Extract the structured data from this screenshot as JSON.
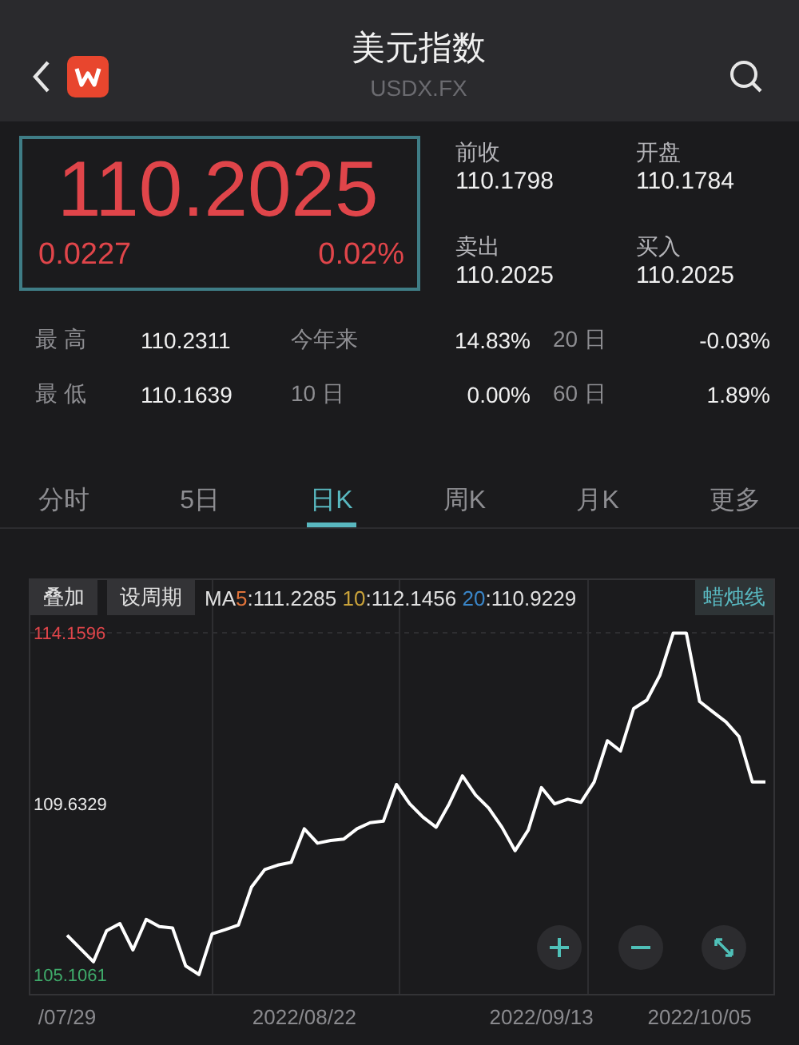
{
  "header": {
    "title": "美元指数",
    "subtitle": "USDX.FX"
  },
  "quote": {
    "price": "110.2025",
    "change": "0.0227",
    "change_pct": "0.02%",
    "fields": [
      {
        "label": "前收",
        "value": "110.1798"
      },
      {
        "label": "开盘",
        "value": "110.1784"
      },
      {
        "label": "卖出",
        "value": "110.2025"
      },
      {
        "label": "买入",
        "value": "110.2025"
      }
    ]
  },
  "stats": [
    [
      {
        "label": "最 高",
        "value": "110.2311"
      },
      {
        "label": "今年来",
        "value": "14.83%"
      },
      {
        "label": "20 日",
        "value": "-0.03%"
      }
    ],
    [
      {
        "label": "最 低",
        "value": "110.1639"
      },
      {
        "label": "10 日",
        "value": "0.00%"
      },
      {
        "label": "60 日",
        "value": "1.89%"
      }
    ]
  ],
  "tabs": [
    {
      "label": "分时",
      "selected": false
    },
    {
      "label": "5日",
      "selected": false
    },
    {
      "label": "日K",
      "selected": true
    },
    {
      "label": "周K",
      "selected": false
    },
    {
      "label": "月K",
      "selected": false
    },
    {
      "label": "更多",
      "selected": false
    }
  ],
  "chart": {
    "buttons": [
      "叠加",
      "设周期"
    ],
    "ma_prefix": "MA",
    "ma": [
      {
        "period": "5",
        "value": ":111.2285",
        "color": "#e0733a"
      },
      {
        "period": "10",
        "value": ":112.1456",
        "color": "#c9a23a"
      },
      {
        "period": "20",
        "value": ":110.9229",
        "color": "#3a86c9"
      }
    ],
    "mode": "蜡烛线",
    "chart_data": {
      "type": "line",
      "categories": [
        "/07/29",
        null,
        null,
        null,
        null,
        null,
        null,
        null,
        null,
        null,
        null,
        null,
        null,
        null,
        null,
        null,
        null,
        null,
        "2022/08/22",
        null,
        null,
        null,
        null,
        null,
        null,
        null,
        null,
        null,
        null,
        null,
        null,
        null,
        null,
        null,
        null,
        null,
        "2022/09/13",
        null,
        null,
        null,
        null,
        null,
        null,
        null,
        null,
        null,
        null,
        null,
        "2022/10/05",
        null,
        null,
        null,
        null,
        null
      ],
      "series": [
        {
          "color": "#ffffff",
          "values": [
            106.15,
            105.8,
            105.45,
            106.27,
            106.46,
            105.76,
            106.57,
            106.38,
            106.34,
            105.34,
            105.11,
            106.19,
            106.3,
            106.42,
            107.43,
            107.89,
            108.01,
            108.08,
            108.97,
            108.59,
            108.66,
            108.7,
            108.97,
            109.13,
            109.17,
            110.14,
            109.63,
            109.28,
            109.01,
            109.63,
            110.37,
            109.86,
            109.52,
            109.01,
            108.39,
            108.94,
            110.06,
            109.63,
            109.75,
            109.67,
            110.21,
            111.3,
            111.03,
            112.15,
            112.38,
            113.04,
            114.15,
            114.15,
            112.34,
            112.07,
            111.8,
            111.41,
            110.21,
            110.21
          ]
        }
      ],
      "ylim": [
        105.1061,
        114.1596
      ],
      "yticks": [
        {
          "value": 114.1596,
          "label": "114.1596"
        },
        {
          "value": 109.6329,
          "label": "109.6329"
        },
        {
          "value": 105.1061,
          "label": "105.1061"
        }
      ]
    }
  }
}
